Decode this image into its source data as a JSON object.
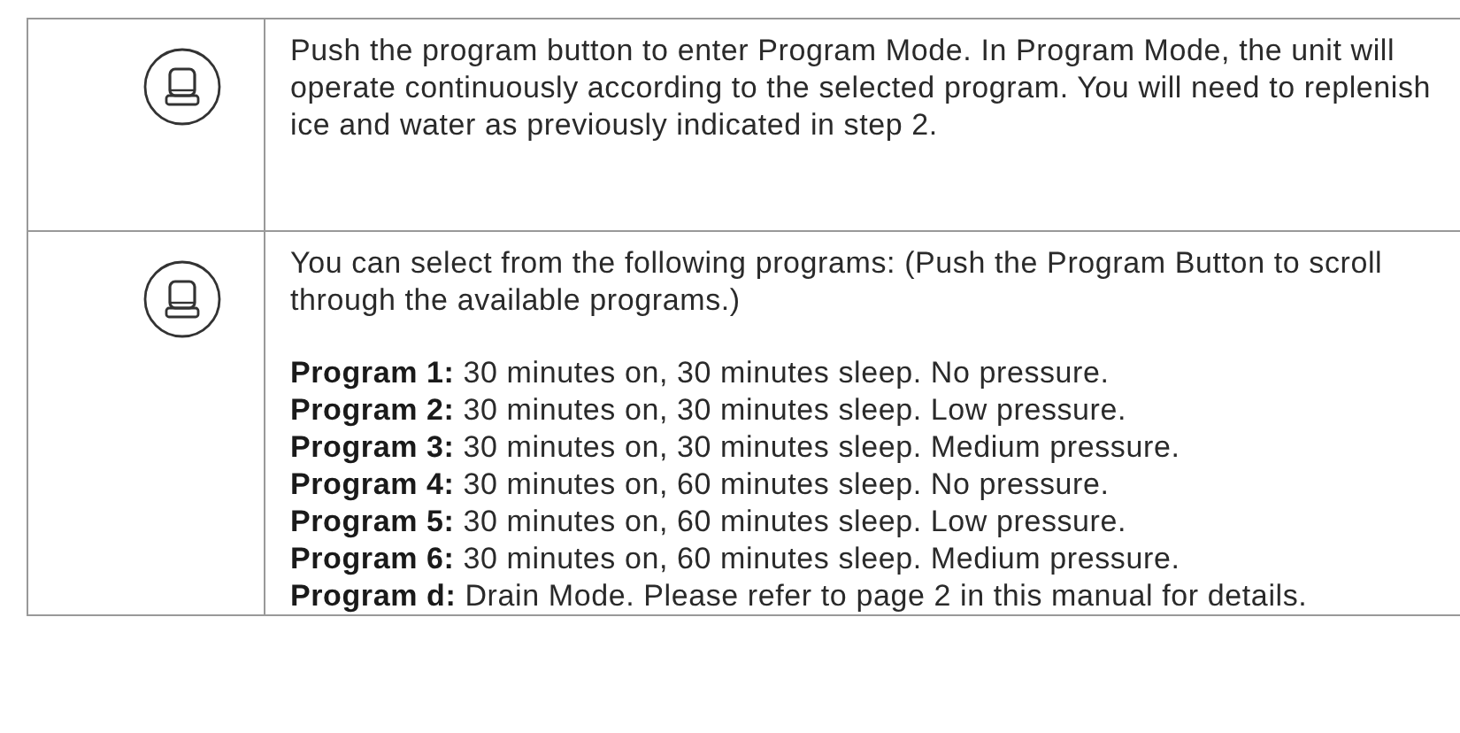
{
  "steps": [
    {
      "intro": "Push the program button to enter Program Mode. In Program Mode, the unit will operate continuously according to the selected program. You will need to replenish ice and water as previously indicated in step 2."
    },
    {
      "intro": "You can select from the following programs: (Push the Program Button to scroll through the available programs.)",
      "programs": [
        "**Program 1:** 30 minutes on, 30 minutes sleep. No pressure.",
        "**Program 2:** 30 minutes on, 30 minutes sleep. Low pressure.",
        "**Program 3:** 30 minutes on, 30 minutes sleep. Medium pressure.",
        "**Program 4:** 30 minutes on, 60 minutes sleep. No pressure.",
        "**Program 5:** 30 minutes on, 60 minutes sleep. Low pressure.",
        "**Program 6:** 30 minutes on, 60 minutes sleep. Medium pressure.",
        "**Program d:** Drain Mode. Please refer to page 2 in this manual for details."
      ]
    }
  ]
}
